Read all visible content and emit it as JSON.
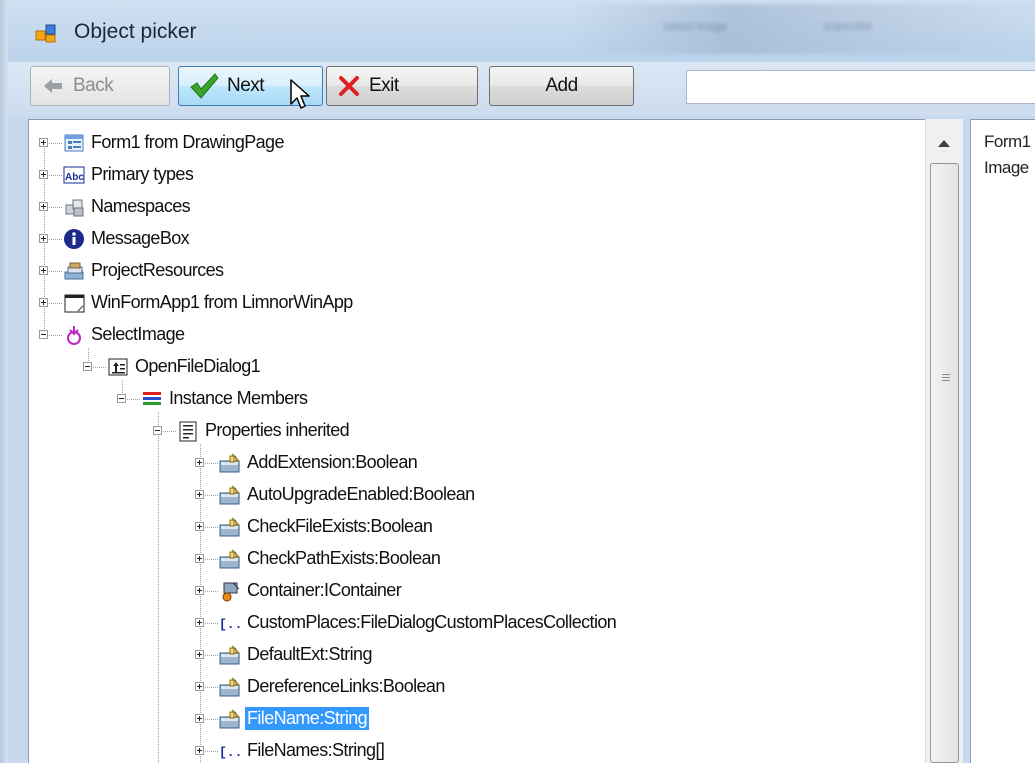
{
  "window": {
    "title": "Object picker",
    "background_title_1": "Select Image",
    "background_title_2": "Subscribe"
  },
  "toolbar": {
    "back_label": "Back",
    "next_label": "Next",
    "exit_label": "Exit",
    "add_label": "Add",
    "search_value": ""
  },
  "tree": {
    "items": [
      {
        "label": "Form1 from DrawingPage",
        "icon": "form-icon",
        "expanded": false,
        "level": 0
      },
      {
        "label": "Primary types",
        "icon": "abc-text-icon",
        "expanded": false,
        "level": 0
      },
      {
        "label": "Namespaces",
        "icon": "namespace-blocks-icon",
        "expanded": false,
        "level": 0
      },
      {
        "label": "MessageBox",
        "icon": "info-icon",
        "expanded": false,
        "level": 0
      },
      {
        "label": "ProjectResources",
        "icon": "resources-icon",
        "expanded": false,
        "level": 0
      },
      {
        "label": "WinFormApp1 from LimnorWinApp",
        "icon": "app-window-icon",
        "expanded": false,
        "level": 0
      },
      {
        "label": "SelectImage",
        "icon": "method-icon",
        "expanded": true,
        "level": 0
      },
      {
        "label": "OpenFileDialog1",
        "icon": "dialog-component-icon",
        "expanded": true,
        "level": 1
      },
      {
        "label": "Instance Members",
        "icon": "members-icon",
        "expanded": true,
        "level": 2
      },
      {
        "label": "Properties inherited",
        "icon": "properties-list-icon",
        "expanded": true,
        "level": 3
      },
      {
        "label": "AddExtension:Boolean",
        "icon": "property-icon",
        "expanded": false,
        "level": 4
      },
      {
        "label": "AutoUpgradeEnabled:Boolean",
        "icon": "property-icon",
        "expanded": false,
        "level": 4
      },
      {
        "label": "CheckFileExists:Boolean",
        "icon": "property-icon",
        "expanded": false,
        "level": 4
      },
      {
        "label": "CheckPathExists:Boolean",
        "icon": "property-icon",
        "expanded": false,
        "level": 4
      },
      {
        "label": "Container:IContainer",
        "icon": "container-property-icon",
        "expanded": false,
        "level": 4
      },
      {
        "label": "CustomPlaces:FileDialogCustomPlacesCollection",
        "icon": "collection-icon",
        "expanded": false,
        "level": 4
      },
      {
        "label": "DefaultExt:String",
        "icon": "property-icon",
        "expanded": false,
        "level": 4
      },
      {
        "label": "DereferenceLinks:Boolean",
        "icon": "property-icon",
        "expanded": false,
        "level": 4
      },
      {
        "label": "FileName:String",
        "icon": "property-icon",
        "expanded": false,
        "level": 4,
        "selected": true
      },
      {
        "label": "FileNames:String[]",
        "icon": "collection-icon",
        "expanded": false,
        "level": 4
      }
    ]
  },
  "details": {
    "line1": "Form1",
    "line2": "Image"
  },
  "colors": {
    "selection": "#3399ff",
    "title_bar": "#c7d9ee",
    "next_check": "#3aa52b",
    "exit_x": "#e02020"
  }
}
